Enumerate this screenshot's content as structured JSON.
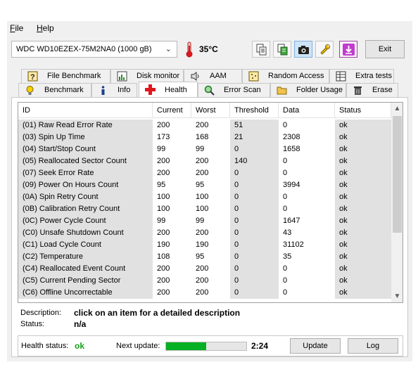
{
  "menu": {
    "file": "ile",
    "file_mnemonic": "F",
    "help": "elp",
    "help_mnemonic": "H"
  },
  "toolbar": {
    "drive": "WDC WD10EZEX-75M2NA0 (1000 gB)",
    "temperature": "35°C",
    "exit_label": "Exit",
    "icons": [
      "thermometer-icon",
      "copy-icon",
      "copy-green-icon",
      "camera-icon",
      "wrench-icon",
      "download-icon"
    ]
  },
  "tabs": {
    "row1": [
      "File Benchmark",
      "Disk monitor",
      "AAM",
      "Random Access",
      "Extra tests"
    ],
    "row2": [
      "Benchmark",
      "Info",
      "Health",
      "Error Scan",
      "Folder Usage",
      "Erase"
    ]
  },
  "columns": [
    "ID",
    "Current",
    "Worst",
    "Threshold",
    "Data",
    "Status"
  ],
  "rows": [
    [
      "(01) Raw Read Error Rate",
      "200",
      "200",
      "51",
      "0",
      "ok"
    ],
    [
      "(03) Spin Up Time",
      "173",
      "168",
      "21",
      "2308",
      "ok"
    ],
    [
      "(04) Start/Stop Count",
      "99",
      "99",
      "0",
      "1658",
      "ok"
    ],
    [
      "(05) Reallocated Sector Count",
      "200",
      "200",
      "140",
      "0",
      "ok"
    ],
    [
      "(07) Seek Error Rate",
      "200",
      "200",
      "0",
      "0",
      "ok"
    ],
    [
      "(09) Power On Hours Count",
      "95",
      "95",
      "0",
      "3994",
      "ok"
    ],
    [
      "(0A) Spin Retry Count",
      "100",
      "100",
      "0",
      "0",
      "ok"
    ],
    [
      "(0B) Calibration Retry Count",
      "100",
      "100",
      "0",
      "0",
      "ok"
    ],
    [
      "(0C) Power Cycle Count",
      "99",
      "99",
      "0",
      "1647",
      "ok"
    ],
    [
      "(C0) Unsafe Shutdown Count",
      "200",
      "200",
      "0",
      "43",
      "ok"
    ],
    [
      "(C1) Load Cycle Count",
      "190",
      "190",
      "0",
      "31102",
      "ok"
    ],
    [
      "(C2) Temperature",
      "108",
      "95",
      "0",
      "35",
      "ok"
    ],
    [
      "(C4) Reallocated Event Count",
      "200",
      "200",
      "0",
      "0",
      "ok"
    ],
    [
      "(C5) Current Pending Sector",
      "200",
      "200",
      "0",
      "0",
      "ok"
    ],
    [
      "(C6) Offline Uncorrectable",
      "200",
      "200",
      "0",
      "0",
      "ok"
    ]
  ],
  "details": {
    "description_label": "Description:",
    "description": "click on an item for a detailed description",
    "status_label": "Status:",
    "status": "n/a"
  },
  "footer": {
    "health_label": "Health status:",
    "health_value": "ok",
    "next_update_label": "Next update:",
    "progress_fraction": 0.5,
    "next_update_time": "2:24",
    "update_button": "Update",
    "log_button": "Log"
  },
  "colors": {
    "health_ok": "#1aa11a",
    "progress": "#06b025",
    "selected_tab_cross": "#e0161e"
  }
}
